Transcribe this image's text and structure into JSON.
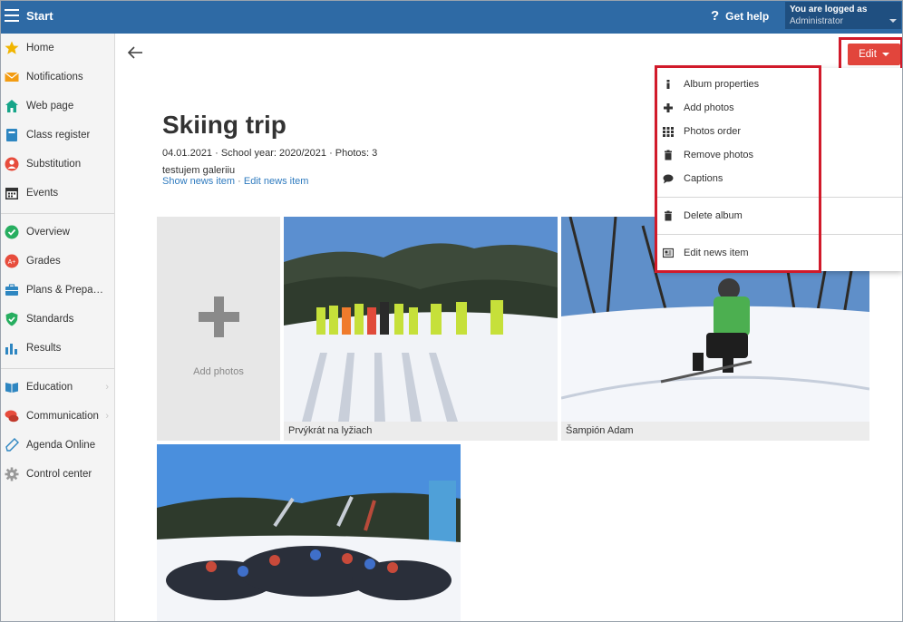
{
  "app": {
    "title": "Start"
  },
  "header": {
    "help_label": "Get help",
    "user_line1": "You are logged as",
    "user_line2": "Administrator"
  },
  "sidebar": {
    "groups": [
      [
        {
          "label": "Home",
          "icon": "star-icon",
          "color": "#f1b500"
        },
        {
          "label": "Notifications",
          "icon": "envelope-icon",
          "color": "#f39c12"
        },
        {
          "label": "Web page",
          "icon": "house-icon",
          "color": "#17a589"
        },
        {
          "label": "Class register",
          "icon": "book-icon",
          "color": "#2e86c1"
        },
        {
          "label": "Substitution",
          "icon": "person-icon",
          "color": "#e74c3c"
        },
        {
          "label": "Events",
          "icon": "calendar-icon",
          "color": "#333333"
        }
      ],
      [
        {
          "label": "Overview",
          "icon": "check-circle-icon",
          "color": "#27ae60"
        },
        {
          "label": "Grades",
          "icon": "grades-icon",
          "color": "#e74c3c"
        },
        {
          "label": "Plans & Preparations",
          "icon": "briefcase-icon",
          "color": "#2e86c1"
        },
        {
          "label": "Standards",
          "icon": "shield-icon",
          "color": "#27ae60"
        },
        {
          "label": "Results",
          "icon": "bar-chart-icon",
          "color": "#2e86c1"
        }
      ],
      [
        {
          "label": "Education",
          "icon": "open-book-icon",
          "color": "#2e86c1",
          "chevron": true
        },
        {
          "label": "Communication",
          "icon": "chat-icon",
          "color": "#e74c3c",
          "chevron": true
        },
        {
          "label": "Agenda Online",
          "icon": "pen-icon",
          "color": "#2e86c1"
        },
        {
          "label": "Control center",
          "icon": "gear-icon",
          "color": "#999999"
        }
      ]
    ]
  },
  "toolbar": {
    "edit_label": "Edit"
  },
  "album": {
    "title": "Skiing trip",
    "meta": "04.01.2021 · School year: 2020/2021 · Photos: 3",
    "description": "testujem galeriiu",
    "link_show": "Show news item",
    "link_sep": "·",
    "link_edit": "Edit news item",
    "add_photos_label": "Add photos",
    "photos": [
      {
        "caption": "Prvýkrát na lyžiach"
      },
      {
        "caption": "Šampión Adam"
      },
      {
        "caption": ""
      }
    ]
  },
  "menu": {
    "items": [
      {
        "label": "Album properties",
        "icon": "info-icon"
      },
      {
        "label": "Add photos",
        "icon": "plus-icon"
      },
      {
        "label": "Photos order",
        "icon": "grid-icon"
      },
      {
        "label": "Remove photos",
        "icon": "trash-icon"
      },
      {
        "label": "Captions",
        "icon": "comment-icon"
      }
    ],
    "delete_label": "Delete album",
    "edit_news_label": "Edit news item"
  }
}
